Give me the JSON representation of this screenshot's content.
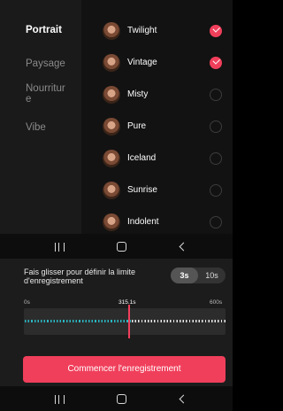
{
  "categories": [
    {
      "label": "Portrait",
      "active": true
    },
    {
      "label": "Paysage",
      "active": false
    },
    {
      "label": "Nourritur\ne",
      "active": false
    },
    {
      "label": "Vibe",
      "active": false
    }
  ],
  "filters": [
    {
      "name": "Twilight",
      "selected": true
    },
    {
      "name": "Vintage",
      "selected": true
    },
    {
      "name": "Misty",
      "selected": false
    },
    {
      "name": "Pure",
      "selected": false
    },
    {
      "name": "Iceland",
      "selected": false
    },
    {
      "name": "Sunrise",
      "selected": false
    },
    {
      "name": "Indolent",
      "selected": false
    }
  ],
  "recording": {
    "hint": "Fais glisser pour définir la limite d'enregistrement",
    "durations": [
      "3s",
      "10s"
    ],
    "selected_duration": "3s",
    "scale_start": "0s",
    "cursor_time": "315.1s",
    "scale_end": "600s",
    "cursor_value_s": 315.1,
    "max_value_s": 600,
    "start_button": "Commencer l'enregistrement"
  },
  "colors": {
    "accent": "#f03f5b",
    "recorded_wave": "#2ab5c0"
  },
  "icons": {
    "nav_recent": "recent-apps-icon",
    "nav_home": "home-icon",
    "nav_back": "back-icon"
  }
}
